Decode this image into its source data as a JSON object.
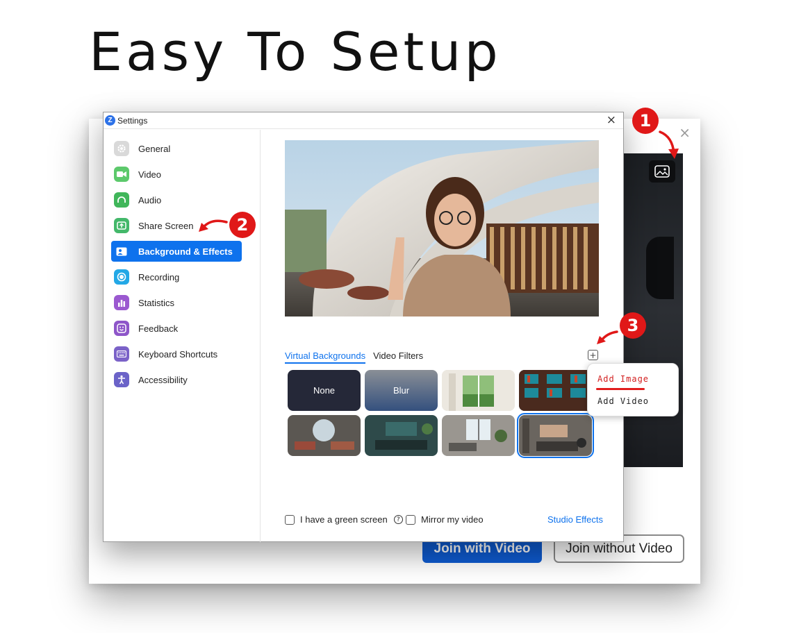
{
  "hero": {
    "title": "Easy To Setup"
  },
  "back_window": {
    "close_glyph": "×",
    "join_with_video": "Join with Video",
    "join_without_video": "Join without Video"
  },
  "settings": {
    "title": "Settings",
    "close_glyph": "×",
    "sidebar": [
      {
        "label": "General",
        "icon": "gear-icon",
        "color": "#d9d9d9"
      },
      {
        "label": "Video",
        "icon": "video-camera-icon",
        "color": "#5cc96b"
      },
      {
        "label": "Audio",
        "icon": "headphones-icon",
        "color": "#40b65a"
      },
      {
        "label": "Share Screen",
        "icon": "share-screen-icon",
        "color": "#43b86a"
      },
      {
        "label": "Background & Effects",
        "icon": "background-person-icon",
        "color": "#0e72ed",
        "active": true
      },
      {
        "label": "Recording",
        "icon": "record-icon",
        "color": "#23a8e6"
      },
      {
        "label": "Statistics",
        "icon": "bar-chart-icon",
        "color": "#9b59d0"
      },
      {
        "label": "Feedback",
        "icon": "smiley-icon",
        "color": "#8e56c9"
      },
      {
        "label": "Keyboard Shortcuts",
        "icon": "keyboard-icon",
        "color": "#7b62c8"
      },
      {
        "label": "Accessibility",
        "icon": "accessibility-icon",
        "color": "#6b63c8"
      }
    ],
    "tabs": [
      {
        "label": "Virtual Backgrounds",
        "active": true
      },
      {
        "label": "Video Filters",
        "active": false
      }
    ],
    "add_glyph": "+",
    "thumbnails": [
      {
        "label": "None"
      },
      {
        "label": "Blur"
      },
      {
        "label": ""
      },
      {
        "label": ""
      },
      {
        "label": ""
      },
      {
        "label": ""
      },
      {
        "label": ""
      },
      {
        "label": "",
        "selected": true
      }
    ],
    "green_screen_label": "I have a green screen",
    "help_glyph": "?",
    "mirror_label": "Mirror my video",
    "studio_effects": "Studio Effects"
  },
  "popup": {
    "add_image": "Add Image",
    "add_video": "Add Video"
  },
  "badges": [
    "1",
    "2",
    "3"
  ],
  "colors": {
    "accent": "#0e72ed",
    "badge_red": "#e01818",
    "join_blue": "#0e5bd1"
  }
}
